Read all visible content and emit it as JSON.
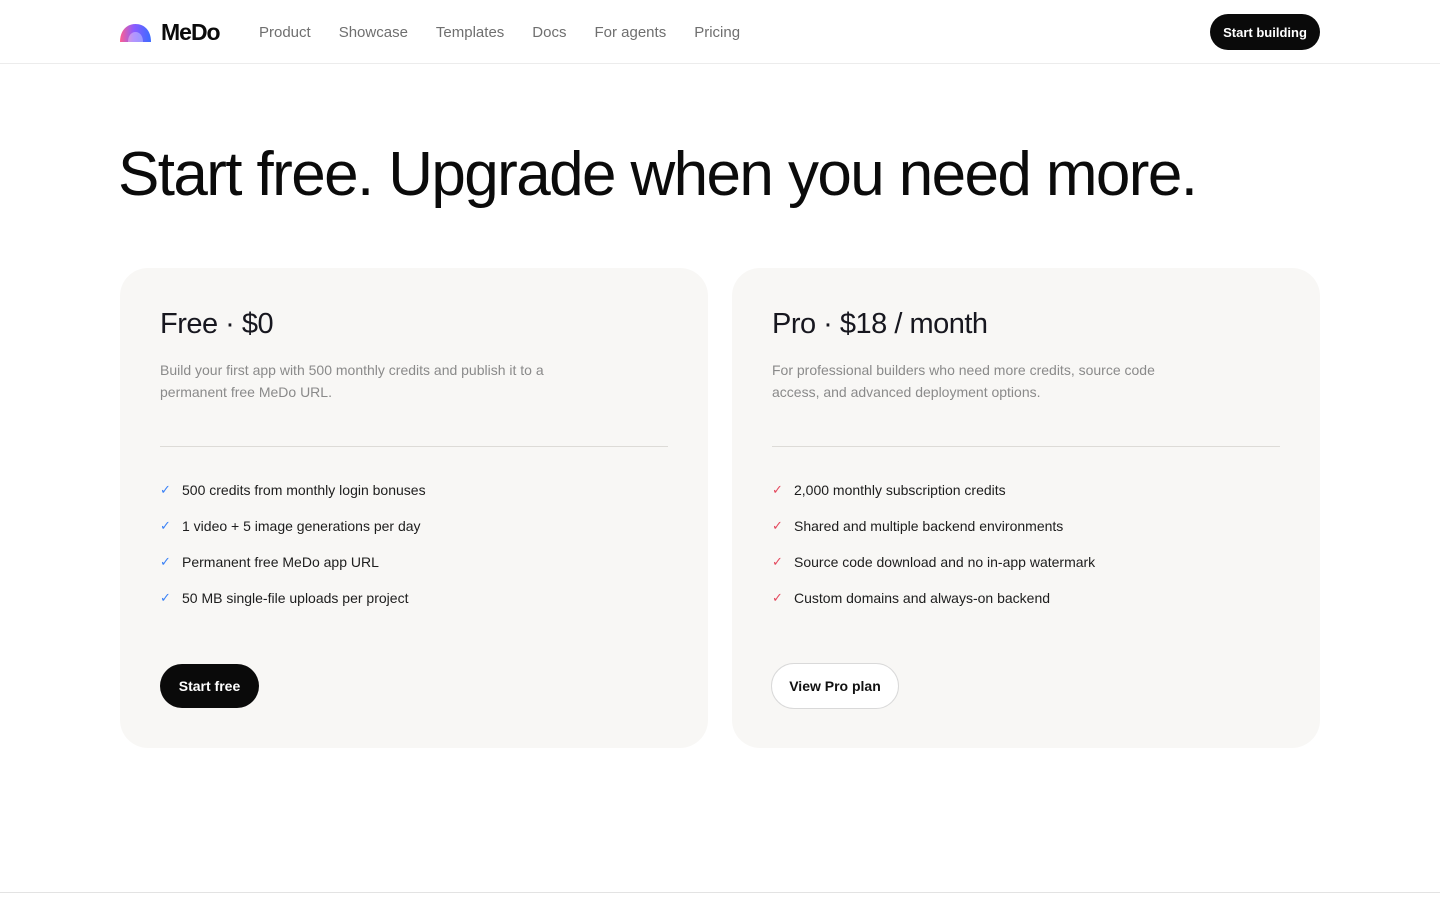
{
  "brand": {
    "name": "MeDo",
    "logo_icon": "rainbow-arc-icon"
  },
  "nav": {
    "items": [
      {
        "label": "Product"
      },
      {
        "label": "Showcase"
      },
      {
        "label": "Templates"
      },
      {
        "label": "Docs"
      },
      {
        "label": "For agents"
      },
      {
        "label": "Pricing"
      }
    ],
    "cta_label": "Start building"
  },
  "hero": {
    "headline": "Start free. Upgrade when you need more."
  },
  "plans": {
    "free": {
      "title": "Free · $0",
      "description": "Build your first app with 500 monthly credits and publish it to a permanent free MeDo URL.",
      "check_icon": "check-icon",
      "check_color": "#3b82f6",
      "features": [
        "500 credits from monthly login bonuses",
        "1 video + 5 image generations per day",
        "Permanent free MeDo app URL",
        "50 MB single-file uploads per project"
      ],
      "button_label": "Start free"
    },
    "pro": {
      "title": "Pro · $18 / month",
      "description": "For professional builders who need more credits, source code access, and advanced deployment options.",
      "check_icon": "check-icon",
      "check_color": "#e4495e",
      "features": [
        "2,000 monthly subscription credits",
        "Shared and multiple backend environments",
        "Source code download and no in-app watermark",
        "Custom domains and always-on backend"
      ],
      "button_label": "View Pro plan"
    }
  },
  "colors": {
    "primary": "#0a0a0a",
    "card_bg": "#f8f7f5",
    "muted_text": "#8a8a8a"
  }
}
